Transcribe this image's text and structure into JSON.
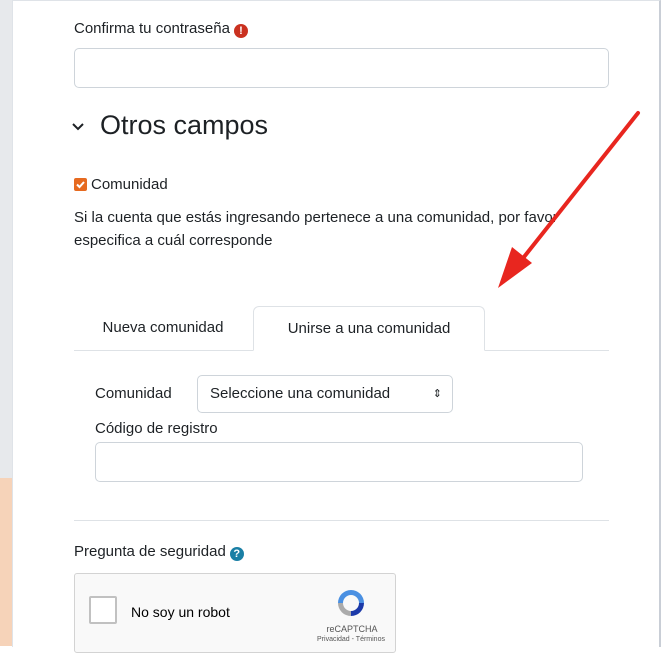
{
  "confirm_password": {
    "label": "Confirma tu contraseña",
    "required_icon": "exclamation-circle-icon",
    "value": ""
  },
  "section": {
    "title": "Otros campos",
    "icon": "chevron-down-icon"
  },
  "community_checkbox": {
    "label": "Comunidad",
    "checked": true,
    "color": "#e66a20"
  },
  "help_text": "Si la cuenta que estás ingresando pertenece a una comunidad, por favor especifica a cuál corresponde",
  "tabs": [
    {
      "label": "Nueva comunidad",
      "active": false
    },
    {
      "label": "Unirse a una comunidad",
      "active": true
    }
  ],
  "community_select": {
    "label": "Comunidad",
    "selected": "Seleccione una comunidad",
    "arrow": "⇕"
  },
  "registration_code": {
    "label": "Código de registro",
    "value": ""
  },
  "security": {
    "label": "Pregunta de seguridad",
    "help_icon": "question-circle-icon"
  },
  "recaptcha": {
    "checkbox_label": "No soy un robot",
    "brand": "reCAPTCHA",
    "links": "Privacidad - Términos"
  },
  "annotation": {
    "color": "#e8261f",
    "icon": "red-arrow-icon"
  }
}
